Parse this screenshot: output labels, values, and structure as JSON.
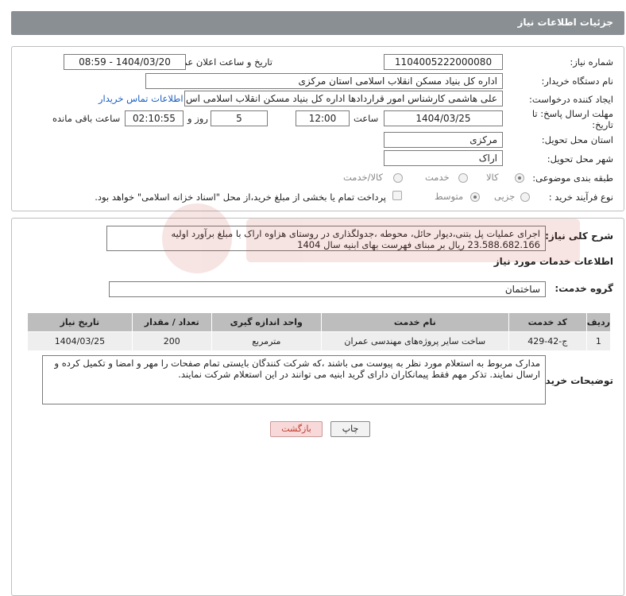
{
  "header": {
    "title": "جزئیات اطلاعات نیاز"
  },
  "form": {
    "need_number_label": "شماره نیاز:",
    "need_number": "1104005222000080",
    "announce_label": "تاریخ و ساعت اعلان عمومی:",
    "announce_value": "1404/03/20 - 08:59",
    "buyer_label": "نام دستگاه خریدار:",
    "buyer_value": "اداره کل بنیاد مسکن انقلاب اسلامی استان مرکزی",
    "creator_label": "ایجاد کننده درخواست:",
    "creator_value": "علی هاشمی کارشناس امور قراردادها اداره کل بنیاد مسکن انقلاب اسلامی اس",
    "contact_link": "اطلاعات تماس خریدار",
    "deadline_label_1": "مهلت ارسال پاسخ: تا",
    "deadline_label_2": "تاریخ:",
    "deadline_date": "1404/03/25",
    "time_label": "ساعت",
    "deadline_time": "12:00",
    "days_value": "5",
    "days_label": "روز و",
    "remaining_value": "02:10:55",
    "remaining_label": "ساعت باقی مانده",
    "province_label": "استان محل تحویل:",
    "province_value": "مرکزی",
    "city_label": "شهر محل تحویل:",
    "city_value": "اراک",
    "category_label": "طبقه بندی موضوعی:",
    "category_options": [
      "کالا",
      "خدمت",
      "کالا/خدمت"
    ],
    "process_label": "نوع فرآیند خرید :",
    "process_options": [
      "جزیی",
      "متوسط"
    ],
    "payment_note": "پرداخت تمام یا بخشی از مبلغ خرید،از محل \"اسناد خزانه اسلامی\" خواهد بود."
  },
  "summary": {
    "label": "شرح کلی نیاز:",
    "line1": "اجرای عملیات پل بتنی،دیوار حائل، محوطه ،جدولگذاری در روستای هزاوه اراک  با مبلغ برآورد اولیه",
    "line2": "23.588.682.166 ریال بر مبنای فهرست بهای ابنیه سال 1404"
  },
  "services": {
    "section_title": "اطلاعات خدمات مورد نیاز",
    "group_label": "گروه خدمت:",
    "group_value": "ساختمان",
    "columns": [
      "ردیف",
      "کد خدمت",
      "نام خدمت",
      "واحد اندازه گیری",
      "تعداد / مقدار",
      "تاریخ نیاز"
    ],
    "rows": [
      [
        "1",
        "ج-42-429",
        "ساخت سایر پروژه‌های مهندسی عمران",
        "مترمربع",
        "200",
        "1404/03/25"
      ]
    ]
  },
  "buyer_notes": {
    "label": "توضیحات خریدار:",
    "text": "مدارک مربوط به استعلام مورد نظر به پیوست می باشند ،که شرکت کنندگان بایستی تمام صفحات را مهر و امضا و تکمیل کرده و ارسال نمایند. تذکر مهم فقط پیمانکاران دارای گرید ابنیه می توانند در این استعلام شرکت نمایند."
  },
  "buttons": {
    "print": "چاپ",
    "back": "بازگشت"
  },
  "colors": {
    "header": "#8a8f93",
    "table_header": "#bdbdbd",
    "back_text": "#c0392b"
  }
}
